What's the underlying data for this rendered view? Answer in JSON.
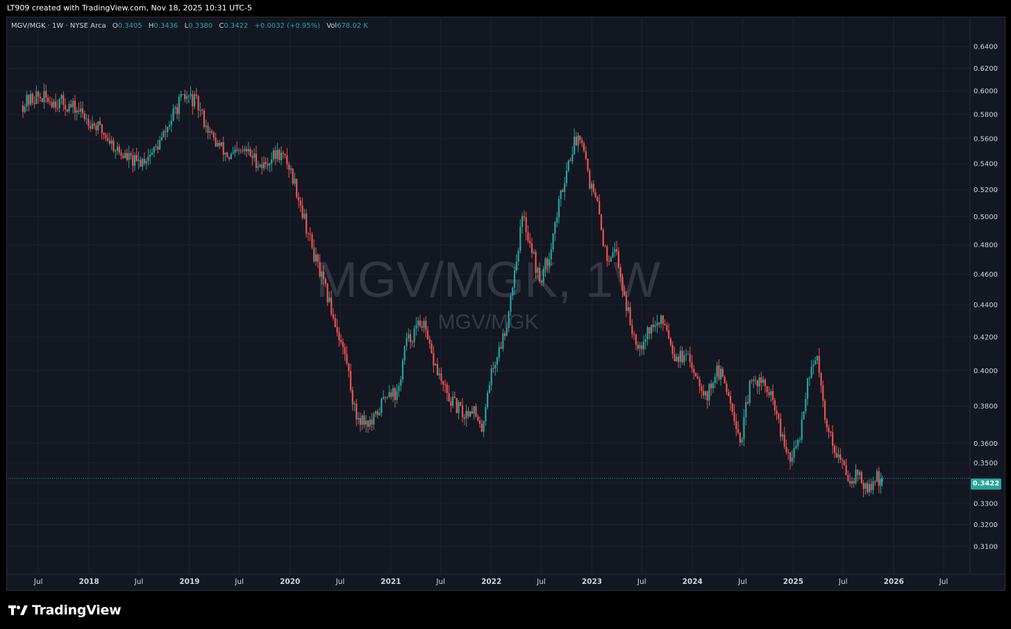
{
  "header": {
    "caption": "LT909 created with TradingView.com, Nov 18, 2025 10:31 UTC-5"
  },
  "legend": {
    "symbol": "MGV/MGK · 1W · NYSE Arca",
    "o_label": "O",
    "o": "0.3405",
    "h_label": "H",
    "h": "0.3436",
    "l_label": "L",
    "l": "0.3380",
    "c_label": "C",
    "c": "0.3422",
    "change": "+0.0032 (+0.95%)",
    "vol_label": "Vol",
    "vol": "678.02 K"
  },
  "watermark": {
    "main": "MGV/MGK, 1W",
    "sub": "MGV/MGK"
  },
  "last_price": "0.3422",
  "branding": {
    "name": "TradingView"
  },
  "colors": {
    "up": "#26a69a",
    "down": "#ef5350",
    "background": "#131722",
    "grid": "#1e222d",
    "text": "#d1d4dc"
  },
  "chart_data": {
    "type": "candlestick",
    "scale": "log",
    "y_ticks": [
      0.31,
      0.32,
      0.33,
      0.34,
      0.35,
      0.36,
      0.38,
      0.4,
      0.42,
      0.44,
      0.46,
      0.48,
      0.5,
      0.52,
      0.54,
      0.56,
      0.58,
      0.6,
      0.62,
      0.64
    ],
    "x_ticks": [
      "Jul",
      "2018",
      "Jul",
      "2019",
      "Jul",
      "2020",
      "Jul",
      "2021",
      "Jul",
      "2022",
      "Jul",
      "2023",
      "Jul",
      "2024",
      "Jul",
      "2025",
      "Jul",
      "2026",
      "Jul"
    ],
    "x_tick_dates": [
      "2017-07",
      "2018-01",
      "2018-07",
      "2019-01",
      "2019-07",
      "2020-01",
      "2020-07",
      "2021-01",
      "2021-07",
      "2022-01",
      "2022-07",
      "2023-01",
      "2023-07",
      "2024-01",
      "2024-07",
      "2025-01",
      "2025-07",
      "2026-01",
      "2026-07"
    ],
    "y_range": [
      0.302,
      0.655
    ],
    "last_price_line": 0.3422,
    "anchors": [
      [
        "2017-05",
        0.587
      ],
      [
        "2017-07",
        0.595
      ],
      [
        "2017-10",
        0.59
      ],
      [
        "2017-12",
        0.583
      ],
      [
        "2018-03",
        0.565
      ],
      [
        "2018-05",
        0.548
      ],
      [
        "2018-07",
        0.54
      ],
      [
        "2018-09",
        0.55
      ],
      [
        "2018-10",
        0.56
      ],
      [
        "2018-12",
        0.59
      ],
      [
        "2019-01",
        0.595
      ],
      [
        "2019-02",
        0.59
      ],
      [
        "2019-04",
        0.56
      ],
      [
        "2019-06",
        0.545
      ],
      [
        "2019-08",
        0.55
      ],
      [
        "2019-10",
        0.538
      ],
      [
        "2019-11",
        0.545
      ],
      [
        "2019-12",
        0.548
      ],
      [
        "2020-01",
        0.54
      ],
      [
        "2020-02",
        0.52
      ],
      [
        "2020-04",
        0.475
      ],
      [
        "2020-06",
        0.44
      ],
      [
        "2020-08",
        0.405
      ],
      [
        "2020-09",
        0.375
      ],
      [
        "2020-11",
        0.37
      ],
      [
        "2021-01",
        0.39
      ],
      [
        "2021-02",
        0.385
      ],
      [
        "2021-03",
        0.415
      ],
      [
        "2021-05",
        0.43
      ],
      [
        "2021-06",
        0.41
      ],
      [
        "2021-08",
        0.385
      ],
      [
        "2021-10",
        0.375
      ],
      [
        "2021-11",
        0.38
      ],
      [
        "2021-12",
        0.365
      ],
      [
        "2022-01",
        0.395
      ],
      [
        "2022-03",
        0.425
      ],
      [
        "2022-05",
        0.5
      ],
      [
        "2022-06",
        0.48
      ],
      [
        "2022-07",
        0.455
      ],
      [
        "2022-08",
        0.47
      ],
      [
        "2022-10",
        0.53
      ],
      [
        "2022-11",
        0.555
      ],
      [
        "2022-12",
        0.565
      ],
      [
        "2023-01",
        0.525
      ],
      [
        "2023-02",
        0.505
      ],
      [
        "2023-03",
        0.47
      ],
      [
        "2023-04",
        0.48
      ],
      [
        "2023-05",
        0.45
      ],
      [
        "2023-06",
        0.425
      ],
      [
        "2023-07",
        0.415
      ],
      [
        "2023-08",
        0.425
      ],
      [
        "2023-10",
        0.43
      ],
      [
        "2023-11",
        0.41
      ],
      [
        "2024-01",
        0.405
      ],
      [
        "2024-02",
        0.395
      ],
      [
        "2024-03",
        0.385
      ],
      [
        "2024-04",
        0.4
      ],
      [
        "2024-05",
        0.395
      ],
      [
        "2024-06",
        0.38
      ],
      [
        "2024-07",
        0.36
      ],
      [
        "2024-08",
        0.39
      ],
      [
        "2024-09",
        0.395
      ],
      [
        "2024-10",
        0.39
      ],
      [
        "2024-11",
        0.38
      ],
      [
        "2024-12",
        0.36
      ],
      [
        "2025-01",
        0.35
      ],
      [
        "2025-02",
        0.365
      ],
      [
        "2025-03",
        0.395
      ],
      [
        "2025-04",
        0.41
      ],
      [
        "2025-05",
        0.375
      ],
      [
        "2025-06",
        0.36
      ],
      [
        "2025-07",
        0.35
      ],
      [
        "2025-08",
        0.342
      ],
      [
        "2025-09",
        0.345
      ],
      [
        "2025-10",
        0.335
      ],
      [
        "2025-11",
        0.342
      ]
    ]
  }
}
